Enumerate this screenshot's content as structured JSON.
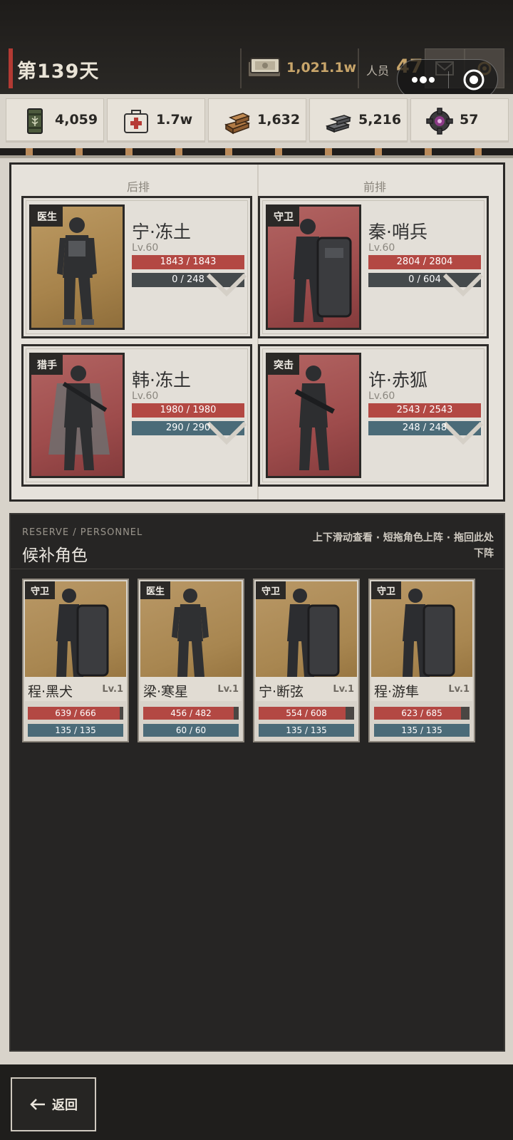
{
  "header": {
    "day": "第139天",
    "money": "1,021.1w",
    "personnel_label": "人员",
    "personnel_count": "47"
  },
  "resources": [
    {
      "icon": "grain-barrel-icon",
      "value": "4,059"
    },
    {
      "icon": "medkit-icon",
      "value": "1.7w"
    },
    {
      "icon": "wood-planks-icon",
      "value": "1,632"
    },
    {
      "icon": "steel-bars-icon",
      "value": "5,216"
    },
    {
      "icon": "gear-chip-icon",
      "value": "57"
    }
  ],
  "formation": {
    "back_label": "后排",
    "front_label": "前排",
    "slots": [
      {
        "role": "医生",
        "name": "宁·冻土",
        "level": "Lv.60",
        "hp": "1843 / 1843",
        "hp_ratio": 1.0,
        "mp": "0 / 248",
        "mp_ratio": 0.0,
        "bg": "gold"
      },
      {
        "role": "守卫",
        "name": "秦·哨兵",
        "level": "Lv.60",
        "hp": "2804 / 2804",
        "hp_ratio": 1.0,
        "mp": "0 / 604",
        "mp_ratio": 0.0,
        "bg": "red"
      },
      {
        "role": "猎手",
        "name": "韩·冻土",
        "level": "Lv.60",
        "hp": "1980 / 1980",
        "hp_ratio": 1.0,
        "mp": "290 / 290",
        "mp_ratio": 1.0,
        "bg": "red"
      },
      {
        "role": "突击",
        "name": "许·赤狐",
        "level": "Lv.60",
        "hp": "2543 / 2543",
        "hp_ratio": 1.0,
        "mp": "248 / 248",
        "mp_ratio": 1.0,
        "bg": "red"
      }
    ]
  },
  "reserve": {
    "subtitle": "RESERVE / PERSONNEL",
    "title": "候补角色",
    "hint": "上下滑动查看 · 短拖角色上阵 · 拖回此处下阵",
    "members": [
      {
        "role": "守卫",
        "name": "程·黑犬",
        "level": "Lv.1",
        "hp": "639 / 666",
        "hp_ratio": 0.959,
        "mp": "135 / 135",
        "mp_ratio": 1.0
      },
      {
        "role": "医生",
        "name": "梁·寒星",
        "level": "Lv.1",
        "hp": "456 / 482",
        "hp_ratio": 0.946,
        "mp": "60 / 60",
        "mp_ratio": 1.0
      },
      {
        "role": "守卫",
        "name": "宁·断弦",
        "level": "Lv.1",
        "hp": "554 / 608",
        "hp_ratio": 0.911,
        "mp": "135 / 135",
        "mp_ratio": 1.0
      },
      {
        "role": "守卫",
        "name": "程·游隼",
        "level": "Lv.1",
        "hp": "623 / 685",
        "hp_ratio": 0.909,
        "mp": "135 / 135",
        "mp_ratio": 1.0
      }
    ]
  },
  "footer": {
    "back_label": "返回"
  }
}
